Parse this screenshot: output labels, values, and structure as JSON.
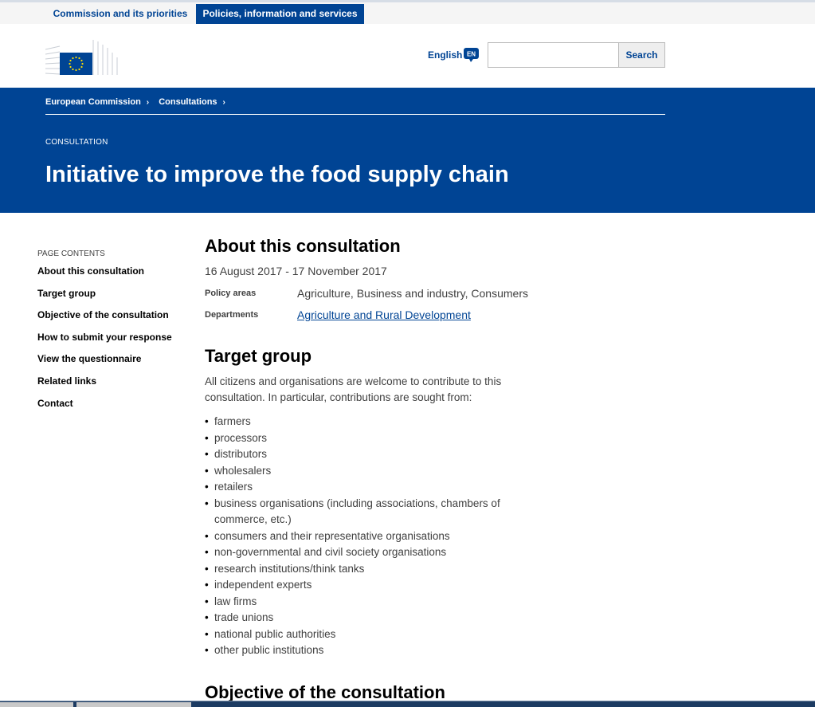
{
  "topnav": {
    "tab_commission": "Commission and its priorities",
    "tab_policies": "Policies, information and services"
  },
  "header": {
    "language": "English",
    "language_code": "EN",
    "search_placeholder": "",
    "search_button": "Search"
  },
  "banner": {
    "breadcrumb": [
      "European Commission",
      "Consultations"
    ],
    "meta_label": "CONSULTATION",
    "title": "Initiative to improve the food supply chain"
  },
  "sidebar": {
    "heading": "PAGE CONTENTS",
    "items": [
      "About this consultation",
      "Target group",
      "Objective of the consultation",
      "How to submit your response",
      "View the questionnaire",
      "Related links",
      "Contact"
    ]
  },
  "about": {
    "heading": "About this consultation",
    "dates": "16 August 2017 - 17 November 2017",
    "policy_label": "Policy areas",
    "policy_value": "Agriculture, Business and industry, Consumers",
    "dept_label": "Departments",
    "dept_value": "Agriculture and Rural Development"
  },
  "target": {
    "heading": "Target group",
    "intro": "All citizens and organisations are welcome to contribute to this consultation. In particular, contributions are sought from:",
    "items": [
      "farmers",
      "processors",
      "distributors",
      "wholesalers",
      "retailers",
      "business organisations (including associations, chambers of commerce, etc.)",
      "consumers and their representative organisations",
      "non-governmental and civil society organisations",
      "research institutions/think tanks",
      "independent experts",
      "law firms",
      "trade unions",
      "national public authorities",
      "other public institutions"
    ]
  },
  "objective": {
    "heading": "Objective of the consultation"
  },
  "colors": {
    "brand_blue": "#004494",
    "eu_star": "#ffdd00"
  }
}
